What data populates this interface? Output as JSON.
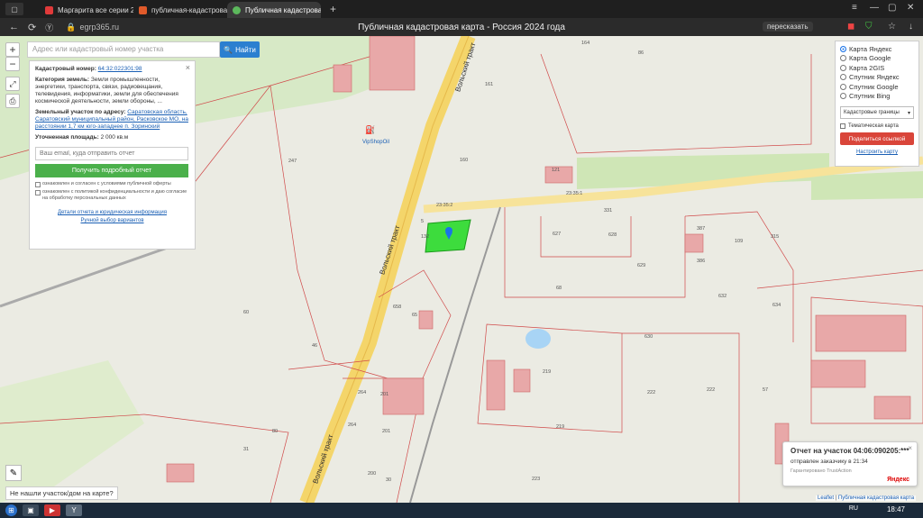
{
  "browser": {
    "tabs": [
      {
        "label": "Маргарита все серии 20",
        "color": "#e03a3a",
        "active": false
      },
      {
        "label": "публичная-кадастровая-",
        "color": "#e05a2a",
        "active": false
      },
      {
        "label": "Публичная кадастровая",
        "color": "#5cb85c",
        "active": true
      }
    ],
    "url": "egrp365.ru",
    "page_title": "Публичная кадастровая карта - Россия 2024 года",
    "translate_label": "пересказать"
  },
  "search": {
    "placeholder": "Адрес или кадастровый номер участка",
    "button_label": "Найти"
  },
  "info_panel": {
    "cadastral_label": "Кадастровый номер:",
    "cadastral_value": "64:32:022301:98",
    "category_label": "Категория земель:",
    "category_value": "Земли промышленности, энергетики, транспорта, связи, радиовещания, телевидения, информатики, земли для обеспечения космической деятельности, земли обороны, ...",
    "address_label": "Земельный участок по адресу:",
    "address_value": "Саратовская область, Саратовский муниципальный район, Расковское МО, на расстоянии 1,7 км юго-западнее п. Зоринский",
    "area_label": "Уточненная площадь:",
    "area_value": "2 000 кв.м",
    "email_placeholder": "Ваш email, куда отправить отчет",
    "get_button": "Получить подробный отчет",
    "agree1": "ознакомлен и согласен с условиями публичной оферты",
    "agree2": "ознакомлен с политикой конфиденциальности и даю согласие на обработку персональных данных",
    "link1": "Детали отчета и юридическая информация",
    "link2": "Ручной выбор вариантов"
  },
  "layers": {
    "options": [
      {
        "label": "Карта Яндекс",
        "selected": true
      },
      {
        "label": "Карта Google",
        "selected": false
      },
      {
        "label": "Карта 2GIS",
        "selected": false
      },
      {
        "label": "Спутник Яндекс",
        "selected": false
      },
      {
        "label": "Спутник Google",
        "selected": false
      },
      {
        "label": "Спутник Bing",
        "selected": false
      }
    ],
    "select_value": "Кадастровые границы",
    "thematic_label": "Тематическая карта",
    "share_button": "Поделиться ссылкой",
    "configure_link": "Настроить карту"
  },
  "map_labels": {
    "road1": "Вольский тракт",
    "road2": "Вольский тракт",
    "road3": "Вольский тракт",
    "poi": "VipShopOil",
    "nums": [
      "247",
      "161",
      "160",
      "164",
      "86",
      "121",
      "23:35:1",
      "23:35:2",
      "331",
      "627",
      "628",
      "629",
      "387",
      "386",
      "109",
      "315",
      "5",
      "132",
      "658",
      "65",
      "68",
      "60",
      "46",
      "632",
      "634",
      "630",
      "219",
      "219",
      "222",
      "222",
      "57",
      "201",
      "264",
      "264",
      "201",
      "200",
      "31",
      "80",
      "30",
      "223"
    ]
  },
  "zoom": {
    "plus": "+",
    "minus": "−"
  },
  "not_found": "Не нашли участок/дом на карте?",
  "notification": {
    "title": "Отчет на участок 04:06:090205:***",
    "status": "отправлен заказчику в 21:34",
    "guarantee": "Гарантировано TrustAction",
    "brand": "Яндекс"
  },
  "attribution": {
    "leaflet": "Leaflet",
    "rosreestr": "Публичная кадастровая карта"
  },
  "taskbar": {
    "clock": "18:47",
    "lang": "RU"
  }
}
